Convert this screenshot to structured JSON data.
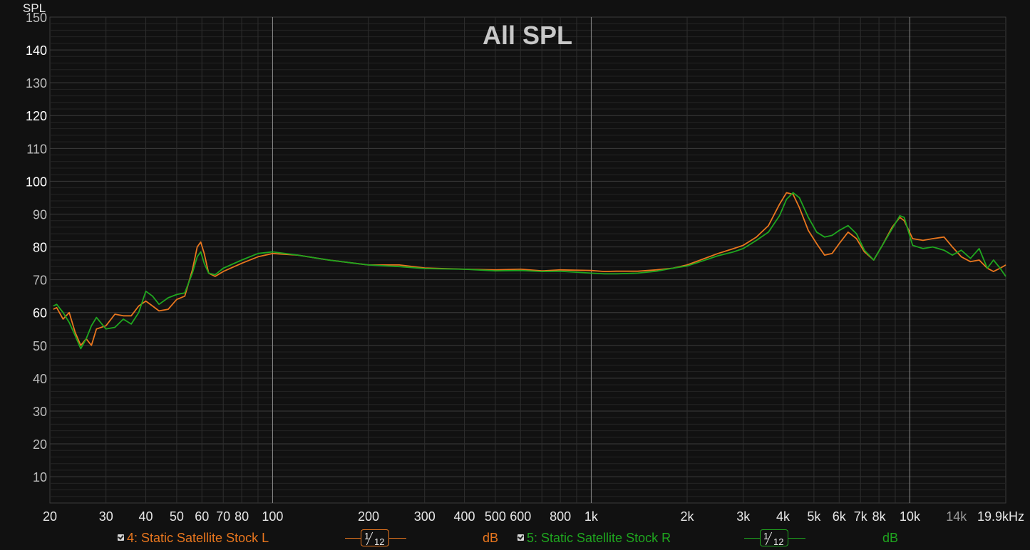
{
  "chart_data": {
    "type": "line",
    "title": "All SPL",
    "ylabel": "SPL",
    "xunit": "Hz",
    "xscale": "log",
    "xlim": [
      20,
      20000
    ],
    "ylim": [
      2,
      150
    ],
    "grid": true,
    "xticks": [
      {
        "v": 20,
        "label": "20"
      },
      {
        "v": 30,
        "label": "30"
      },
      {
        "v": 40,
        "label": "40"
      },
      {
        "v": 50,
        "label": "50"
      },
      {
        "v": 60,
        "label": "60"
      },
      {
        "v": 70,
        "label": "70"
      },
      {
        "v": 80,
        "label": "80"
      },
      {
        "v": 100,
        "label": "100"
      },
      {
        "v": 200,
        "label": "200"
      },
      {
        "v": 300,
        "label": "300"
      },
      {
        "v": 400,
        "label": "400"
      },
      {
        "v": 500,
        "label": "500"
      },
      {
        "v": 600,
        "label": "600"
      },
      {
        "v": 800,
        "label": "800"
      },
      {
        "v": 1000,
        "label": "1k"
      },
      {
        "v": 2000,
        "label": "2k"
      },
      {
        "v": 3000,
        "label": "3k"
      },
      {
        "v": 4000,
        "label": "4k"
      },
      {
        "v": 5000,
        "label": "5k"
      },
      {
        "v": 6000,
        "label": "6k"
      },
      {
        "v": 7000,
        "label": "7k"
      },
      {
        "v": 8000,
        "label": "8k"
      },
      {
        "v": 10000,
        "label": "10k"
      },
      {
        "v": 14000,
        "label": "14k",
        "dim": true
      },
      {
        "v": 19900,
        "label": "19.9kHz"
      }
    ],
    "yticks": [
      10,
      20,
      30,
      40,
      50,
      60,
      70,
      80,
      90,
      100,
      110,
      120,
      130,
      140,
      150
    ],
    "series": [
      {
        "name": "4: Static Satellite Stock L",
        "color": "#e8761e",
        "points": [
          [
            20.5,
            61
          ],
          [
            21,
            61.5
          ],
          [
            22,
            58
          ],
          [
            23,
            60
          ],
          [
            24,
            54
          ],
          [
            25,
            50
          ],
          [
            26,
            52
          ],
          [
            27,
            50
          ],
          [
            28,
            55
          ],
          [
            30,
            56
          ],
          [
            32,
            59.5
          ],
          [
            34,
            59
          ],
          [
            36,
            59
          ],
          [
            38,
            62
          ],
          [
            40,
            63.5
          ],
          [
            42,
            62
          ],
          [
            44,
            60.5
          ],
          [
            47,
            61
          ],
          [
            50,
            64
          ],
          [
            53,
            65
          ],
          [
            56,
            73
          ],
          [
            58,
            80
          ],
          [
            59.5,
            81.5
          ],
          [
            61,
            78
          ],
          [
            63,
            72
          ],
          [
            66,
            71
          ],
          [
            70,
            72.5
          ],
          [
            80,
            75
          ],
          [
            90,
            77
          ],
          [
            100,
            78
          ],
          [
            120,
            77.5
          ],
          [
            150,
            76
          ],
          [
            200,
            74.5
          ],
          [
            250,
            74.5
          ],
          [
            300,
            73.6
          ],
          [
            400,
            73.2
          ],
          [
            500,
            73
          ],
          [
            600,
            73.2
          ],
          [
            700,
            72.7
          ],
          [
            800,
            73
          ],
          [
            1000,
            72.8
          ],
          [
            1100,
            72.5
          ],
          [
            1200,
            72.6
          ],
          [
            1400,
            72.6
          ],
          [
            1600,
            73
          ],
          [
            1800,
            73.5
          ],
          [
            2000,
            74.5
          ],
          [
            2200,
            76
          ],
          [
            2500,
            78
          ],
          [
            2800,
            79.5
          ],
          [
            3000,
            80.5
          ],
          [
            3300,
            83
          ],
          [
            3600,
            86.5
          ],
          [
            3900,
            93
          ],
          [
            4100,
            96.5
          ],
          [
            4300,
            96
          ],
          [
            4500,
            92
          ],
          [
            4800,
            85
          ],
          [
            5100,
            81
          ],
          [
            5400,
            77.5
          ],
          [
            5700,
            78
          ],
          [
            6000,
            81
          ],
          [
            6400,
            84.5
          ],
          [
            6800,
            82.5
          ],
          [
            7200,
            78.5
          ],
          [
            7700,
            76
          ],
          [
            8200,
            80.5
          ],
          [
            8800,
            86
          ],
          [
            9300,
            89
          ],
          [
            9600,
            88
          ],
          [
            10200,
            82.5
          ],
          [
            11000,
            82
          ],
          [
            11800,
            82.5
          ],
          [
            12800,
            83
          ],
          [
            13600,
            80
          ],
          [
            14500,
            77
          ],
          [
            15500,
            75.5
          ],
          [
            16500,
            76
          ],
          [
            17500,
            73.5
          ],
          [
            18300,
            72.5
          ],
          [
            19200,
            73.5
          ],
          [
            20000,
            74.5
          ]
        ]
      },
      {
        "name": "5: Static Satellite Stock R",
        "color": "#1fa61f",
        "points": [
          [
            20.5,
            62
          ],
          [
            21,
            62.5
          ],
          [
            22,
            60
          ],
          [
            23,
            57
          ],
          [
            24,
            53
          ],
          [
            25,
            49
          ],
          [
            26,
            52
          ],
          [
            27,
            56
          ],
          [
            28,
            58.5
          ],
          [
            30,
            55
          ],
          [
            32,
            55.5
          ],
          [
            34,
            58
          ],
          [
            36,
            56.5
          ],
          [
            38,
            60
          ],
          [
            40,
            66.5
          ],
          [
            42,
            65
          ],
          [
            44,
            62.5
          ],
          [
            47,
            64.5
          ],
          [
            50,
            65.5
          ],
          [
            53,
            66
          ],
          [
            56,
            72
          ],
          [
            58,
            77
          ],
          [
            59.5,
            78.5
          ],
          [
            61,
            75
          ],
          [
            63,
            72
          ],
          [
            66,
            71.5
          ],
          [
            70,
            73.5
          ],
          [
            80,
            76
          ],
          [
            90,
            78
          ],
          [
            100,
            78.5
          ],
          [
            120,
            77.5
          ],
          [
            150,
            76
          ],
          [
            200,
            74.5
          ],
          [
            250,
            74
          ],
          [
            300,
            73.4
          ],
          [
            400,
            73.2
          ],
          [
            500,
            72.7
          ],
          [
            600,
            72.8
          ],
          [
            700,
            72.5
          ],
          [
            800,
            72.6
          ],
          [
            1000,
            72
          ],
          [
            1100,
            71.8
          ],
          [
            1200,
            71.8
          ],
          [
            1400,
            72
          ],
          [
            1600,
            72.6
          ],
          [
            1800,
            73.5
          ],
          [
            2000,
            74.2
          ],
          [
            2200,
            75.5
          ],
          [
            2500,
            77.3
          ],
          [
            2800,
            78.5
          ],
          [
            3000,
            79.5
          ],
          [
            3300,
            82
          ],
          [
            3600,
            84.5
          ],
          [
            3900,
            89.5
          ],
          [
            4100,
            94.5
          ],
          [
            4300,
            96.5
          ],
          [
            4500,
            95
          ],
          [
            4800,
            89
          ],
          [
            5100,
            84.5
          ],
          [
            5400,
            83
          ],
          [
            5700,
            83.5
          ],
          [
            6000,
            85
          ],
          [
            6400,
            86.5
          ],
          [
            6800,
            84
          ],
          [
            7200,
            79
          ],
          [
            7700,
            76
          ],
          [
            8200,
            80.5
          ],
          [
            8800,
            85.5
          ],
          [
            9300,
            89.5
          ],
          [
            9600,
            89
          ],
          [
            10200,
            80.5
          ],
          [
            11000,
            79.5
          ],
          [
            11800,
            80
          ],
          [
            12800,
            79
          ],
          [
            13600,
            77.5
          ],
          [
            14500,
            79
          ],
          [
            15500,
            76.5
          ],
          [
            16500,
            79.5
          ],
          [
            17500,
            73.5
          ],
          [
            18300,
            76
          ],
          [
            19200,
            73.5
          ],
          [
            20000,
            71
          ]
        ]
      }
    ]
  },
  "legend": {
    "items": [
      {
        "label": "4: Static Satellite Stock L",
        "color": "#e8761e",
        "smoothing_num": "1",
        "smoothing_den": "12",
        "unit": "dB"
      },
      {
        "label": "5: Static Satellite Stock R",
        "color": "#1fa61f",
        "smoothing_num": "1",
        "smoothing_den": "12",
        "unit": "dB"
      }
    ]
  }
}
